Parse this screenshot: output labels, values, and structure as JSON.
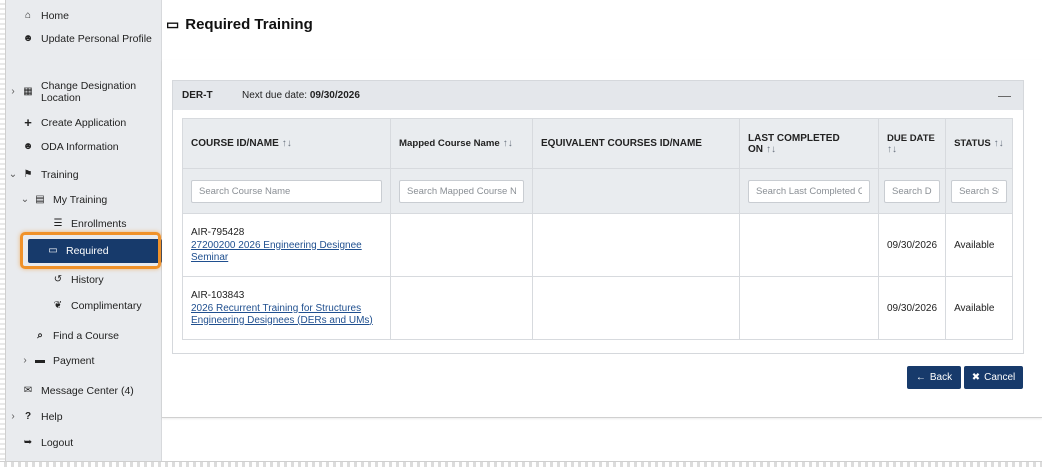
{
  "sidebar": {
    "items": [
      {
        "label": "Home",
        "icon": "home-icon",
        "glyph": "⌂"
      },
      {
        "label": "Update Personal Profile",
        "icon": "user-icon",
        "glyph": "☻"
      },
      {
        "label": "Change Designation Location",
        "icon": "building-icon",
        "glyph": "▦"
      },
      {
        "label": "Create Application",
        "icon": "plus-icon",
        "glyph": "+"
      },
      {
        "label": "ODA Information",
        "icon": "user-icon",
        "glyph": "☻"
      },
      {
        "label": "Training",
        "icon": "chalkboard-icon",
        "glyph": "⚑"
      },
      {
        "label": "My Training",
        "icon": "list-box-icon",
        "glyph": "▤"
      },
      {
        "label": "Enrollments",
        "icon": "list-icon",
        "glyph": "☰"
      },
      {
        "label": "Required",
        "icon": "monitor-icon",
        "glyph": "▭"
      },
      {
        "label": "History",
        "icon": "history-icon",
        "glyph": "↺"
      },
      {
        "label": "Complimentary",
        "icon": "gift-icon",
        "glyph": "❦"
      },
      {
        "label": "Find a Course",
        "icon": "search-icon",
        "glyph": "⌕"
      },
      {
        "label": "Payment",
        "icon": "credit-card-icon",
        "glyph": "▬"
      },
      {
        "label": "Message Center (4)",
        "icon": "envelope-icon",
        "glyph": "✉"
      },
      {
        "label": "Help",
        "icon": "question-icon",
        "glyph": "?"
      },
      {
        "label": "Logout",
        "icon": "logout-icon",
        "glyph": "➥"
      }
    ],
    "chevrons": {
      "collapsed": "›",
      "expanded": "⌄"
    }
  },
  "page": {
    "title": "Required Training",
    "title_icon": "monitor-icon",
    "title_glyph": "▭"
  },
  "panel": {
    "code": "DER-T",
    "due_label": "Next due date:",
    "due_value": "09/30/2026",
    "collapse_glyph": "—"
  },
  "table": {
    "sort_glyph": "↑↓",
    "columns": [
      {
        "label": "COURSE ID/NAME",
        "sortable": true
      },
      {
        "label": "Mapped Course Name",
        "sortable": true
      },
      {
        "label": "EQUIVALENT COURSES ID/NAME",
        "sortable": false
      },
      {
        "label": "LAST COMPLETED ON",
        "sortable": true
      },
      {
        "label": "DUE DATE",
        "sortable": true
      },
      {
        "label": "STATUS",
        "sortable": true
      }
    ],
    "search_placeholders": [
      "Search Course Name",
      "Search Mapped Course Name",
      "Search Last Completed On",
      "Search Due Date",
      "Search Status"
    ],
    "rows": [
      {
        "course_id": "AIR-795428",
        "course_name": "27200200 2026 Engineering Designee Seminar",
        "mapped_course_name": "",
        "equivalent_courses": "",
        "last_completed_on": "",
        "due_date": "09/30/2026",
        "status": "Available"
      },
      {
        "course_id": "AIR-103843",
        "course_name": "2026 Recurrent Training for Structures Engineering Designees (DERs and UMs)",
        "mapped_course_name": "",
        "equivalent_courses": "",
        "last_completed_on": "",
        "due_date": "09/30/2026",
        "status": "Available"
      }
    ]
  },
  "buttons": {
    "back_label": "Back",
    "back_glyph": "←",
    "cancel_label": "Cancel",
    "cancel_glyph": "✖"
  },
  "colors": {
    "primary": "#173a6b",
    "highlight": "#f0922a",
    "link": "#1f4f8f",
    "sidebar_bg": "#e9ebee"
  }
}
